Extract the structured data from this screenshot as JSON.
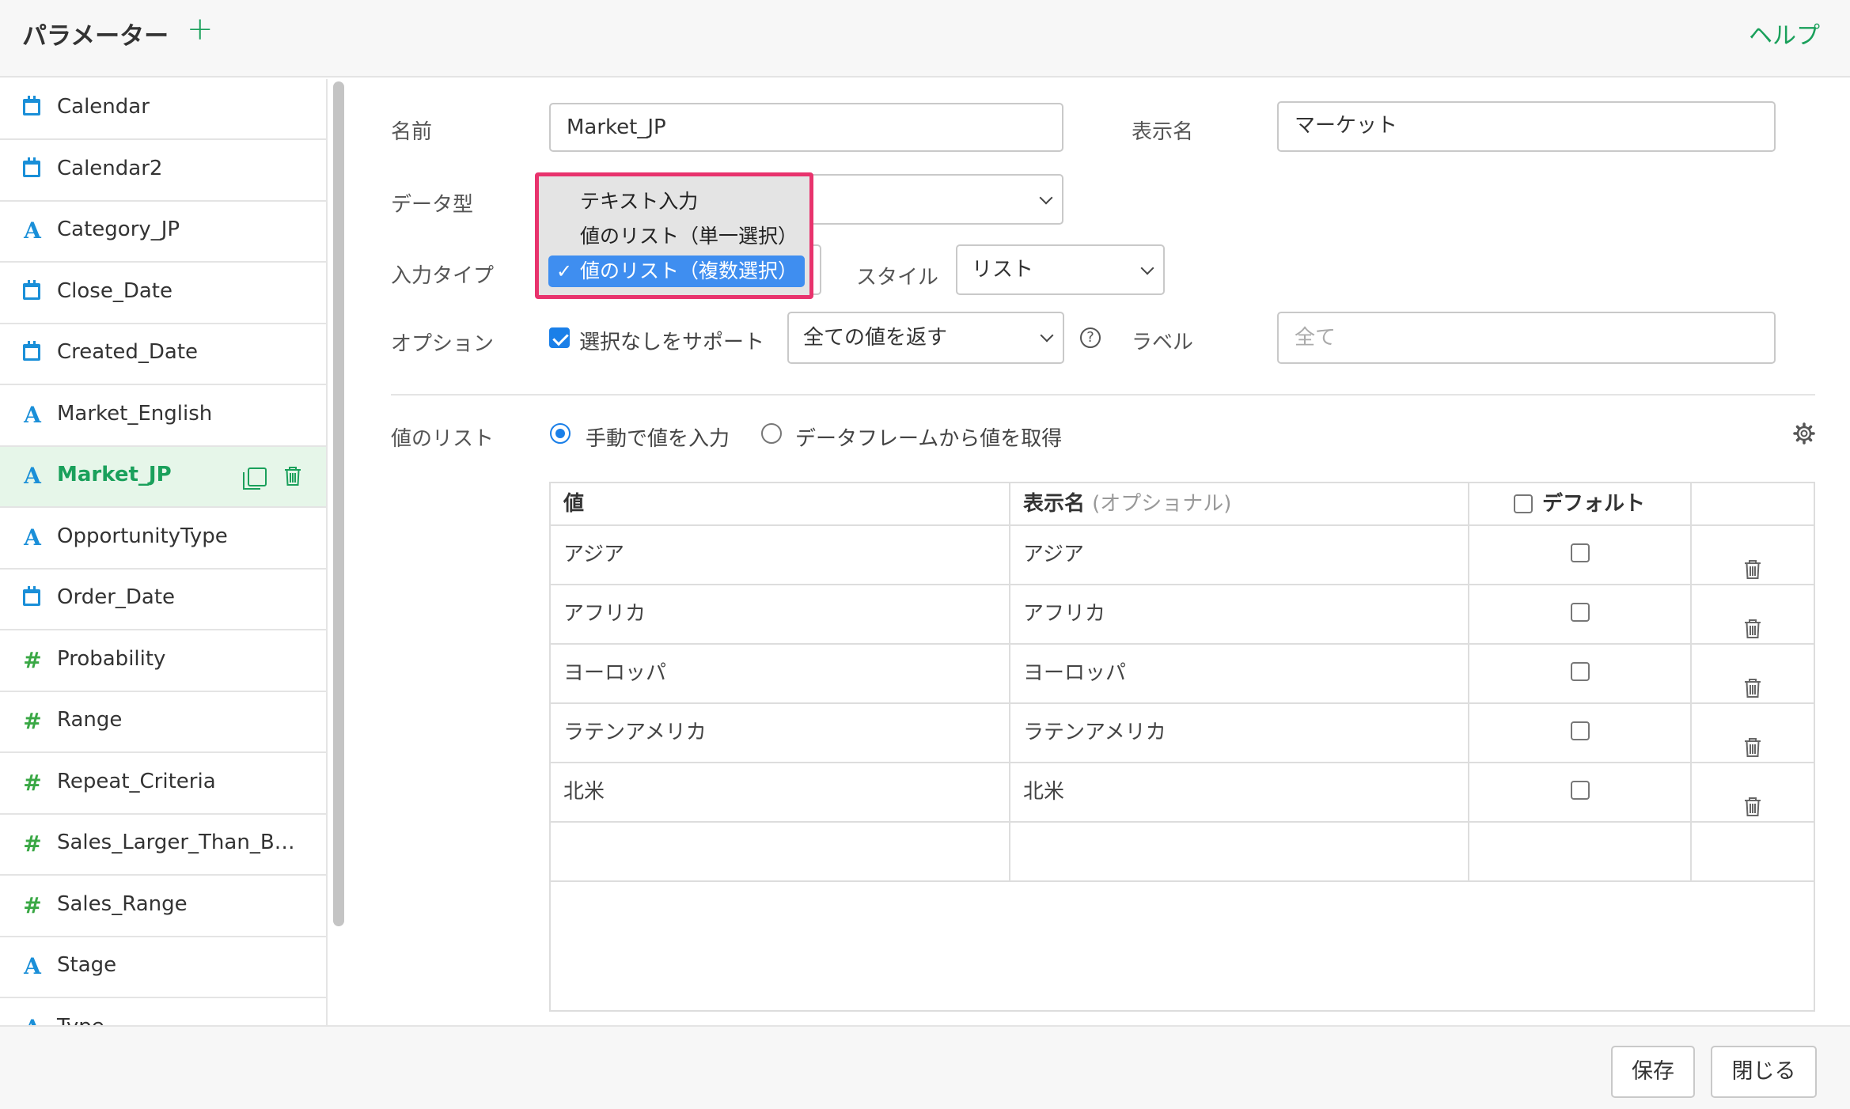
{
  "header": {
    "title": "パラメーター",
    "add_label": "+",
    "help_label": "ヘルプ"
  },
  "sidebar": {
    "items": [
      {
        "label": "Calendar",
        "type": "date"
      },
      {
        "label": "Calendar2",
        "type": "date"
      },
      {
        "label": "Category_JP",
        "type": "string"
      },
      {
        "label": "Close_Date",
        "type": "date"
      },
      {
        "label": "Created_Date",
        "type": "date"
      },
      {
        "label": "Market_English",
        "type": "string"
      },
      {
        "label": "Market_JP",
        "type": "string",
        "active": true
      },
      {
        "label": "OpportunityType",
        "type": "string"
      },
      {
        "label": "Order_Date",
        "type": "date"
      },
      {
        "label": "Probability",
        "type": "number"
      },
      {
        "label": "Range",
        "type": "number"
      },
      {
        "label": "Repeat_Criteria",
        "type": "number"
      },
      {
        "label": "Sales_Larger_Than_B…",
        "type": "number"
      },
      {
        "label": "Sales_Range",
        "type": "number"
      },
      {
        "label": "Stage",
        "type": "string"
      },
      {
        "label": "Type",
        "type": "string"
      }
    ],
    "string_glyph": "A",
    "number_glyph": "#"
  },
  "form": {
    "name_label": "名前",
    "name_value": "Market_JP",
    "display_name_label": "表示名",
    "display_name_value": "マーケット",
    "data_type_label": "データ型",
    "input_type_label": "入力タイプ",
    "style_label": "スタイル",
    "style_value": "リスト",
    "option_label": "オプション",
    "support_none_label": "選択なしをサポート",
    "return_value": "全ての値を返す",
    "help_glyph": "?",
    "label_label": "ラベル",
    "label_placeholder": "全て"
  },
  "dropdown": {
    "check_glyph": "✓",
    "options": [
      "テキスト入力",
      "値のリスト（単一選択）",
      "値のリスト（複数選択）"
    ],
    "selected_index": 2
  },
  "value_list": {
    "label": "値のリスト",
    "manual_label": "手動で値を入力",
    "dataframe_label": "データフレームから値を取得",
    "headers": {
      "value": "値",
      "display": "表示名",
      "display_optional": "(オプショナル)",
      "default": "デフォルト"
    },
    "rows": [
      {
        "value": "アジア",
        "display": "アジア"
      },
      {
        "value": "アフリカ",
        "display": "アフリカ"
      },
      {
        "value": "ヨーロッパ",
        "display": "ヨーロッパ"
      },
      {
        "value": "ラテンアメリカ",
        "display": "ラテンアメリカ"
      },
      {
        "value": "北米",
        "display": "北米"
      }
    ]
  },
  "footer": {
    "save_label": "保存",
    "close_label": "閉じる"
  },
  "colors": {
    "accent_green": "#1aa05b",
    "string_blue": "#1a8fd8",
    "number_green": "#3aa845",
    "highlight": "#e8336d",
    "select_blue": "#3f8ef0"
  }
}
